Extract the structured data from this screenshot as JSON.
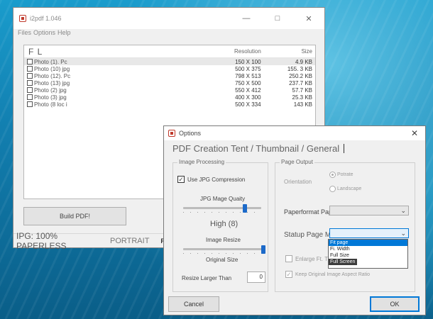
{
  "main_window": {
    "title": "i2pdf 1.046",
    "menu": [
      "Files",
      "Options",
      "Help"
    ],
    "columns": {
      "name": "F L",
      "resolution": "Resolution",
      "size": "Size"
    },
    "rows": [
      {
        "name": "Photo (1). Pc",
        "resolution": "150 X 100",
        "size": "4.9 KB"
      },
      {
        "name": "Photo (10) jpg",
        "resolution": "500 X 375",
        "size": "155. 3 KB"
      },
      {
        "name": "Photo (12). Pc",
        "resolution": "798 X 513",
        "size": "250.2 KB"
      },
      {
        "name": "Photo (13) jpg",
        "resolution": "750 X 500",
        "size": "237.7 KB"
      },
      {
        "name": "Photo (2) jpg",
        "resolution": "550 X 412",
        "size": "57.7 KB"
      },
      {
        "name": "Photo (3) jpg",
        "resolution": "400 X 300",
        "size": "25.3 KB"
      },
      {
        "name": "Photo (8 loc i",
        "resolution": "500 X 334",
        "size": "143 KB"
      }
    ],
    "build_button": "Build PDF!",
    "status": {
      "left": "IPG: 100% PAPERLESS",
      "mid": "PORTRAIT",
      "right": "FIT"
    }
  },
  "options_dialog": {
    "title": "Options",
    "tabs": "PDF Creation Tent / Thumbnail / General",
    "image_processing": {
      "group_label": "Image Processing",
      "use_jpg": "Use JPG Compression",
      "jpg_quality_label": "JPG Mage Quaity",
      "jpg_quality_value": "High (8)",
      "image_resize_label": "Image Resize",
      "original_size_label": "Original Size",
      "resize_larger_label": "Resize Larger Than",
      "resize_larger_value": "0"
    },
    "page_output": {
      "group_label": "Page Output",
      "orientation_label": "Orientation",
      "portrait": "Potrate",
      "landscape": "Landscape",
      "paperformat_label": "Paperformat Paperless",
      "paperformat_value": "",
      "startup_label": "Statup Page Mode",
      "startup_value": "",
      "enlarge_label": "Enlarge Ft. T",
      "keep_aspect_label": "Keep Original Image Aspect Ratio",
      "dropdown_options": [
        "Fit page",
        "Fi. Width",
        "Full Size",
        "Full Screen"
      ]
    },
    "cancel": "Cancel",
    "ok": "OK"
  }
}
